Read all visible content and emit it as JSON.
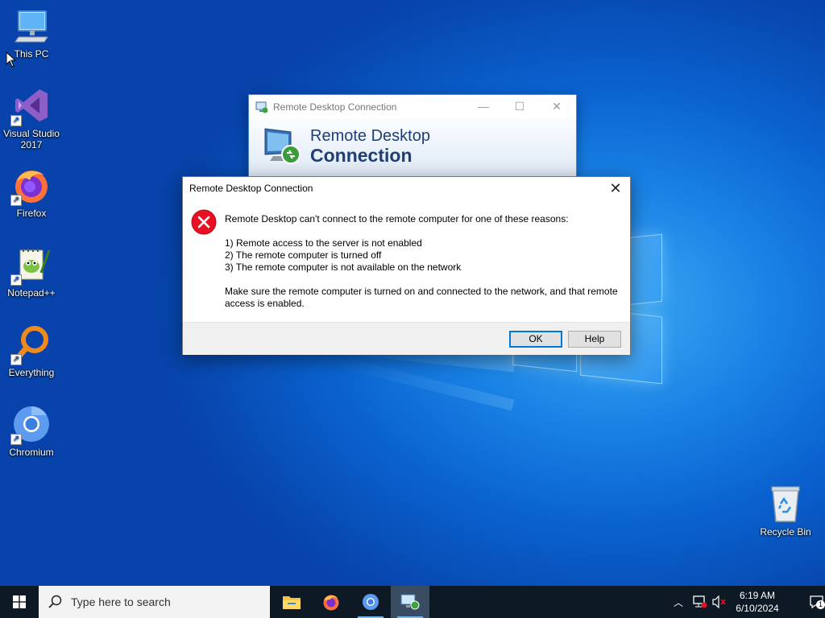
{
  "desktop_icons": [
    {
      "label": "This PC",
      "icon": "this-pc-icon"
    },
    {
      "label": "Visual Studio 2017",
      "icon": "visual-studio-icon"
    },
    {
      "label": "Firefox",
      "icon": "firefox-icon"
    },
    {
      "label": "Notepad++",
      "icon": "notepad-plus-plus-icon"
    },
    {
      "label": "Everything",
      "icon": "everything-icon"
    },
    {
      "label": "Chromium",
      "icon": "chromium-icon"
    },
    {
      "label": "Recycle Bin",
      "icon": "recycle-bin-icon"
    }
  ],
  "rdc_window": {
    "title": "Remote Desktop Connection",
    "banner_line1": "Remote Desktop",
    "banner_line2": "Connection"
  },
  "error_dialog": {
    "title": "Remote Desktop Connection",
    "message": "Remote Desktop can't connect to the remote computer for one of these reasons:",
    "reasons": [
      "1) Remote access to the server is not enabled",
      "2) The remote computer is turned off",
      "3) The remote computer is not available on the network"
    ],
    "advice": "Make sure the remote computer is turned on and connected to the network, and that remote access is enabled.",
    "ok_label": "OK",
    "help_label": "Help"
  },
  "taskbar": {
    "search_placeholder": "Type here to search",
    "apps": [
      "file-explorer-icon",
      "firefox-icon",
      "chromium-icon",
      "remote-desktop-icon"
    ],
    "time": "6:19 AM",
    "date": "6/10/2024",
    "notification_count": "1"
  },
  "colors": {
    "desktop_blue": "#0a62cf",
    "accent": "#0078d7",
    "taskbar": "#0d1a26",
    "error_red": "#e81123"
  }
}
